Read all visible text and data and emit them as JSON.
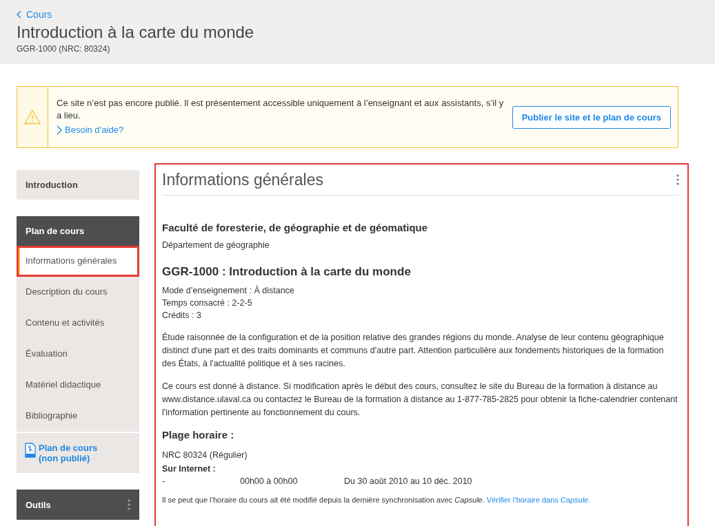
{
  "header": {
    "back_link": "Cours",
    "title": "Introduction à la carte du monde",
    "subtitle": "GGR-1000 (NRC: 80324)"
  },
  "notice": {
    "message": "Ce site n’est pas encore publié. Il est présentement accessible uniquement à l’enseignant et aux assistants, s’il y a lieu.",
    "help_link": "Besoin d’aide?",
    "button": "Publier le site et le plan de cours"
  },
  "sidebar": [
    {
      "kind": "link",
      "label": "Introduction"
    },
    {
      "kind": "group",
      "title": "Plan de cours",
      "items": [
        {
          "label": "Informations générales",
          "selected": true
        },
        {
          "label": "Description du cours",
          "selected": false
        },
        {
          "label": "Contenu et activités",
          "selected": false
        },
        {
          "label": "Évaluation",
          "selected": false
        },
        {
          "label": "Matériel didactique",
          "selected": false
        },
        {
          "label": "Bibliographie",
          "selected": false
        }
      ],
      "download": "Plan de cours (non publié)"
    },
    {
      "kind": "tools",
      "title": "Outils"
    }
  ],
  "panel": {
    "title": "Informations générales",
    "faculty": "Faculté de foresterie, de géographie et de géomatique",
    "department": "Département de géographie",
    "course_title": "GGR-1000 : Introduction à la carte du monde",
    "details": [
      "Mode d’enseignement : À distance",
      "Temps consacré : 2-2-5",
      "Crédits : 3"
    ],
    "paragraphs": [
      "Étude raisonnée de la configuration et de la position relative des grandes régions du monde. Analyse de leur contenu géographique distinct d'une part et des traits dominants et communs d'autre part. Attention particulière aux fondements historiques de la formation des États, à l'actualité politique et à ses racines.",
      "Ce cours est donné à distance. Si modification après le début des cours, consultez le site du Bureau de la formation à distance au www.distance.ulaval.ca ou contactez le Bureau de la formation à distance au 1-877-785-2825 pour obtenir la fiche-calendrier contenant l'information pertinente au fonctionnement du cours."
    ],
    "schedule_heading": "Plage horaire :",
    "section": "NRC 80324 (Régulier)",
    "mode": "Sur Internet :",
    "schedule_row": {
      "day": "-",
      "time": "00h00 à 00h00",
      "dates": "Du 30 août 2010 au 10 déc. 2010"
    },
    "sync_note": "Il se peut que l’horaire du cours ait été modifié depuis la dernière synchronisation avec *Capsule*.",
    "sync_link": "Vérifier l’horaire dans *Capsule*."
  }
}
